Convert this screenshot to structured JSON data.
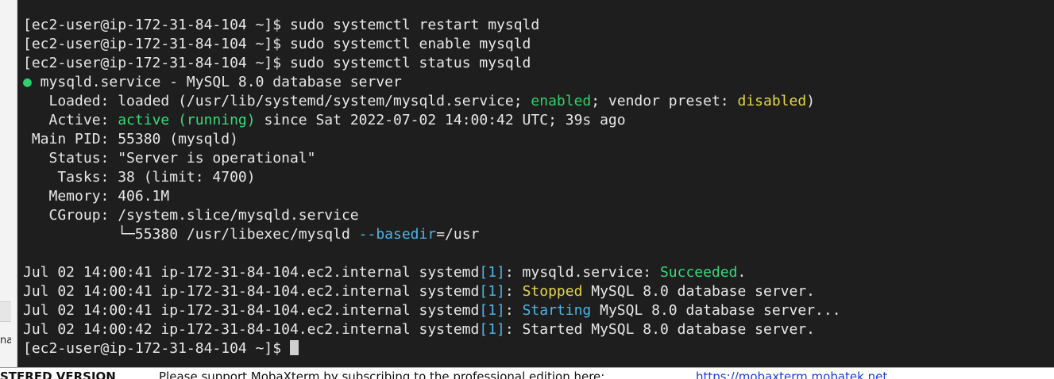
{
  "left_panel": {
    "clipped_text": "na"
  },
  "terminal": {
    "prompt": "[ec2-user@ip-172-31-84-104 ~]$",
    "commands": [
      "sudo systemctl restart mysqld",
      "sudo systemctl enable mysqld",
      "sudo systemctl status mysqld"
    ],
    "service": {
      "bullet": "●",
      "header": " mysqld.service - MySQL 8.0 database server",
      "loaded_label": "   Loaded: ",
      "loaded_pre": "loaded (/usr/lib/systemd/system/mysqld.service; ",
      "loaded_enabled": "enabled",
      "loaded_mid": "; vendor preset: ",
      "loaded_disabled": "disabled",
      "loaded_post": ")",
      "active_label": "   Active: ",
      "active_state": "active (running)",
      "active_since": " since Sat 2022-07-02 14:00:42 UTC; 39s ago",
      "main_pid": " Main PID: 55380 (mysqld)",
      "status": "   Status: \"Server is operational\"",
      "tasks": "    Tasks: 38 (limit: 4700)",
      "memory": "   Memory: 406.1M",
      "cgroup": "   CGroup: /system.slice/mysqld.service",
      "cgroup_child_pre": "           └─55380 /usr/libexec/mysqld ",
      "cgroup_child_opt": "--basedir",
      "cgroup_child_post": "=/usr"
    },
    "log_prefix_a": "Jul 02 14:00:41 ip-172-31-84-104.ec2.internal systemd",
    "log_prefix_b": "Jul 02 14:00:42 ip-172-31-84-104.ec2.internal systemd",
    "log_pid": "[1]",
    "logs": [
      {
        "pre": ": mysqld.service: ",
        "hl": "Succeeded",
        "post": "."
      },
      {
        "pre": ": ",
        "hl": "Stopped",
        "post": " MySQL 8.0 database server."
      },
      {
        "pre": ": ",
        "hl": "Starting",
        "post": " MySQL 8.0 database server..."
      },
      {
        "pre": ": Started MySQL 8.0 database server."
      }
    ],
    "colors": {
      "green": "#2fd16b",
      "yellow": "#e5d54a",
      "blue": "#4fb3e6",
      "background": "#1e1e1e"
    }
  },
  "status_bar": {
    "label": "STERED VERSION",
    "message": "Please support MobaXterm by subscribing to the professional edition here:",
    "link": "https://mobaxterm.mobatek.net"
  }
}
